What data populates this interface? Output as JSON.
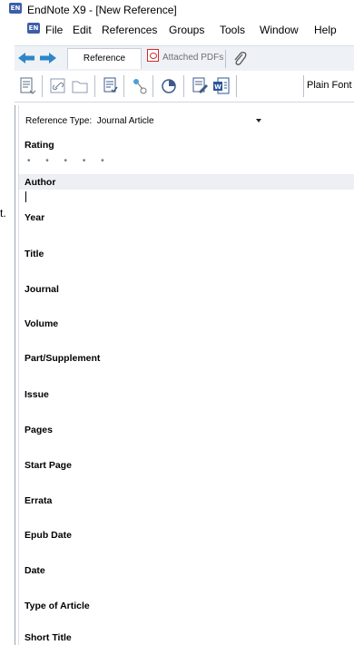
{
  "window": {
    "title": "EndNote X9 - [New Reference]",
    "app_icon_text": "EN"
  },
  "menu": [
    "File",
    "Edit",
    "References",
    "Groups",
    "Tools",
    "Window",
    "Help"
  ],
  "tabs": {
    "reference": "Reference",
    "attached_pdfs": "Attached PDFs"
  },
  "toolbar": {
    "font_label": "Plain Font"
  },
  "reference": {
    "type_label": "Reference Type:",
    "type_value": "Journal Article",
    "rating_label": "Rating",
    "rating_value": 0,
    "fields": [
      "Author",
      "Year",
      "Title",
      "Journal",
      "Volume",
      "Part/Supplement",
      "Issue",
      "Pages",
      "Start Page",
      "Errata",
      "Epub Date",
      "Date",
      "Type of Article",
      "Short Title"
    ]
  },
  "background_fragment": "t.",
  "colors": {
    "accent": "#3b5ea8",
    "arrow": "#2e86c9",
    "pdf_red": "#d42a2a"
  }
}
